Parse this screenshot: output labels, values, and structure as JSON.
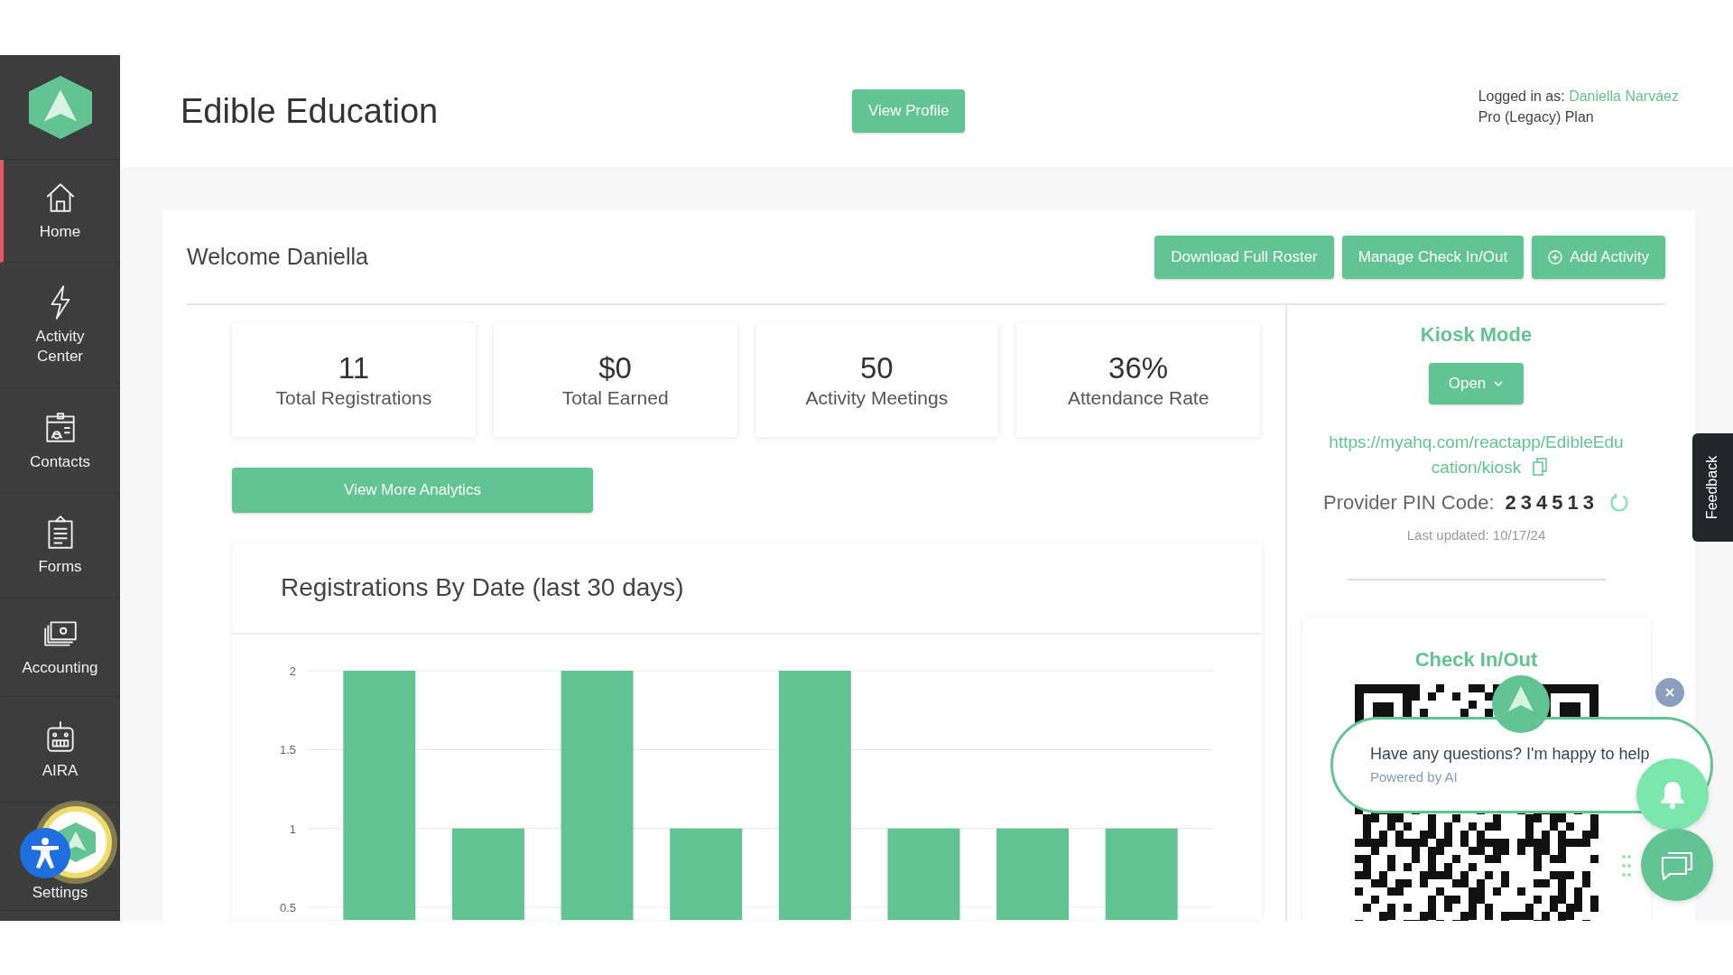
{
  "sidebar": {
    "items": [
      {
        "label": "Home",
        "kind": "home",
        "selected": true
      },
      {
        "label": "Activity Center",
        "kind": "bolt",
        "selected": false
      },
      {
        "label": "Contacts",
        "kind": "contacts",
        "selected": false
      },
      {
        "label": "Forms",
        "kind": "forms",
        "selected": false
      },
      {
        "label": "Accounting",
        "kind": "money",
        "selected": false
      },
      {
        "label": "AIRA",
        "kind": "robot",
        "selected": false
      },
      {
        "label": "Settings",
        "kind": "settings",
        "selected": false
      }
    ]
  },
  "header": {
    "title": "Edible Education",
    "view_profile_button": "View Profile",
    "logged_in_label": "Logged in as:",
    "user_name": "Daniella Narváez",
    "plan": "Pro (Legacy) Plan"
  },
  "welcome": "Welcome Daniella",
  "actions": [
    {
      "label": "Download Full Roster",
      "kind": "plain"
    },
    {
      "label": "Manage Check In/Out",
      "kind": "plain"
    },
    {
      "label": "Add Activity",
      "kind": "add"
    }
  ],
  "stats": [
    {
      "value": "11",
      "label": "Total Registrations"
    },
    {
      "value": "$0",
      "label": "Total Earned"
    },
    {
      "value": "50",
      "label": "Activity Meetings"
    },
    {
      "value": "36%",
      "label": "Attendance Rate"
    }
  ],
  "analytics_button": "View More Analytics",
  "chart": {
    "title": "Registrations By Date (last 30 days)",
    "chart_data": {
      "type": "bar",
      "values": [
        2,
        1,
        2,
        1,
        2,
        1,
        1,
        1
      ],
      "ylim": [
        0.5,
        2
      ],
      "yticks": [
        0.5,
        1,
        1.5,
        2
      ]
    }
  },
  "kiosk": {
    "title": "Kiosk Mode",
    "open_button": "Open",
    "url": "https://myahq.com/reactapp/EdibleEducation/kiosk",
    "pin_label": "Provider PIN Code:",
    "pin": "234513",
    "last_updated": "Last updated: 10/17/24"
  },
  "check_in": {
    "title": "Check In/Out"
  },
  "chat": {
    "message": "Have any questions? I'm happy to help",
    "powered_by": "Powered by AI"
  },
  "feedback_tab": "Feedback"
}
